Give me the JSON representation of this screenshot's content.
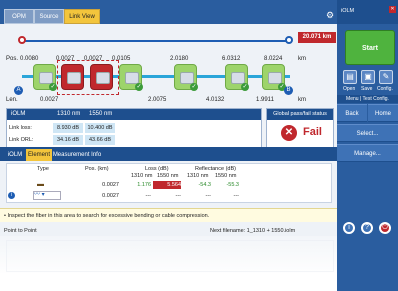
{
  "tabs": [
    "OPM",
    "Source",
    "Link View"
  ],
  "active_tab_index": 2,
  "link_view": {
    "distance_badge": "20.071 km",
    "pos_label": "Pos.",
    "pos_unit": "km",
    "positions": [
      "0.0080",
      "0.0027",
      "0.0027",
      "0.0105",
      "2.0180",
      "6.0312",
      "8.0224"
    ],
    "len_label": "Len.",
    "lengths": [
      "0.0027",
      "2.0075",
      "4.0132",
      "1.9911"
    ],
    "len_unit": "km",
    "end_a": "A",
    "end_b": "B"
  },
  "summary": {
    "title": "iOLM",
    "col1": "1310 nm",
    "col2": "1550 nm",
    "rows": [
      {
        "label": "Link loss:",
        "v1": "8.930 dB",
        "v2": "10.400 dB"
      },
      {
        "label": "Link ORL:",
        "v1": "34.16 dB",
        "v2": "43.66 dB"
      }
    ]
  },
  "pass_fail": {
    "title": "Global pass/fail status",
    "status": "Fail",
    "icon": "x-icon",
    "color": "#c0282d"
  },
  "bottom_tabs": [
    "iOLM",
    "Element",
    "Measurement Info"
  ],
  "bottom_active_index": 1,
  "element_table": {
    "headers": {
      "type": "Type",
      "pos": "Pos. (km)",
      "loss": "Loss (dB)",
      "refl": "Reflectance (dB)",
      "w1": "1310 nm",
      "w2": "1550 nm",
      "w3": "1310 nm",
      "w4": "1550 nm"
    },
    "rows": [
      {
        "pos": "0.0027",
        "l1": "1.176",
        "l2": "5.564",
        "r1": "-54.3",
        "r2": "-55.3"
      },
      {
        "pos": "0.0027",
        "l1": "---",
        "l2": "---",
        "r1": "---",
        "r2": "---"
      }
    ]
  },
  "diagnostic": "• Inspect the fiber in this area to search for excessive bending or cable compression.",
  "status_bar": {
    "left": "Point to Point",
    "right": "Next filename: 1_1310 + 1550.iolm"
  },
  "right_panel": {
    "title": "iOLM",
    "start": "Start",
    "open": "Open",
    "save": "Save",
    "config": "Config.",
    "menu_label": "Menu | Test Config.",
    "back": "Back",
    "home": "Home",
    "select": "Select...",
    "manage": "Manage..."
  }
}
